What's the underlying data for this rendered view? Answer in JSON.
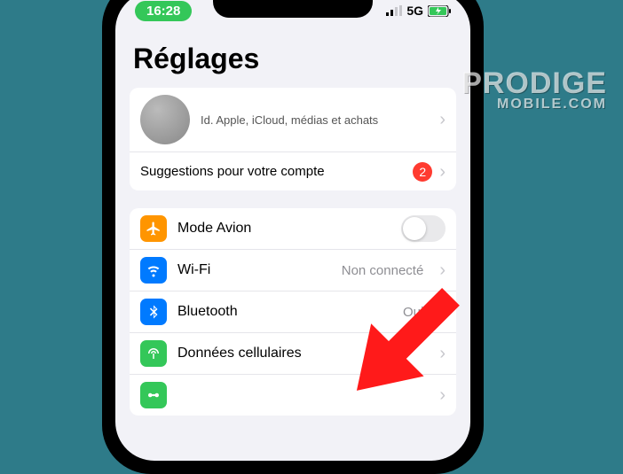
{
  "status": {
    "time": "16:28",
    "network": "5G"
  },
  "page": {
    "title": "Réglages"
  },
  "account": {
    "subtitle": "Id. Apple, iCloud, médias et achats"
  },
  "suggestions": {
    "label": "Suggestions pour votre compte",
    "badge": "2"
  },
  "settings": {
    "airplane": {
      "label": "Mode Avion"
    },
    "wifi": {
      "label": "Wi-Fi",
      "value": "Non connecté"
    },
    "bluetooth": {
      "label": "Bluetooth",
      "value": "Oui"
    },
    "cellular": {
      "label": "Données cellulaires"
    }
  },
  "watermark": {
    "line1": "PRODIGE",
    "line2": "MOBILE.COM"
  }
}
